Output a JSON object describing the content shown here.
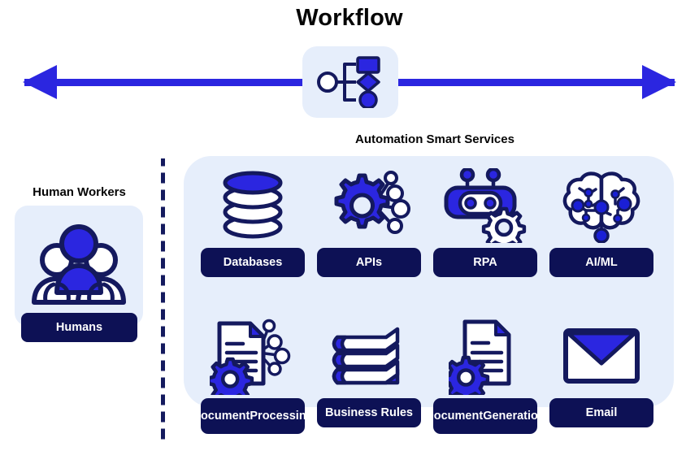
{
  "title": "Workflow",
  "colors": {
    "arrow_blue": "#2B26E0",
    "panel_blue": "#E6EEFB",
    "label_navy": "#0D1155",
    "outline_navy": "#14195E",
    "icon_blue": "#2B26E0",
    "text_black": "#050505",
    "label_text": "#FFFFFF",
    "background": "#FFFFFF"
  },
  "workflow_icon": {
    "name": "workflow-diagram-icon",
    "shapes": [
      "circle-outline",
      "bracket-connector",
      "square-filled",
      "diamond-filled",
      "circle-filled"
    ]
  },
  "arrows": {
    "left": "arrow-left",
    "right": "arrow-right"
  },
  "human_section": {
    "title": "Human Workers",
    "icon": "three-people-icon",
    "label": "Humans"
  },
  "divider": {
    "name": "dashed-vertical-divider",
    "style": "dashed"
  },
  "services_section": {
    "title": "Automation Smart Services",
    "rows": [
      {
        "items": [
          {
            "label": "Databases",
            "label_lines": [
              "Databases"
            ],
            "icon": "database-stack-icon"
          },
          {
            "label": "APIs",
            "label_lines": [
              "APIs"
            ],
            "icon": "gear-network-icon"
          },
          {
            "label": "RPA",
            "label_lines": [
              "RPA"
            ],
            "icon": "robot-gear-icon"
          },
          {
            "label": "AI/ML",
            "label_lines": [
              "AI/ML"
            ],
            "icon": "brain-circuit-icon"
          }
        ]
      },
      {
        "items": [
          {
            "label": "Document Processing",
            "label_lines": [
              "Document",
              "Processing"
            ],
            "icon": "document-gear-network-icon"
          },
          {
            "label": "Business Rules",
            "label_lines": [
              "Business Rules"
            ],
            "icon": "book-stack-icon"
          },
          {
            "label": "Document Generation",
            "label_lines": [
              "Document",
              "Generation"
            ],
            "icon": "document-gear-icon"
          },
          {
            "label": "Email",
            "label_lines": [
              "Email"
            ],
            "icon": "envelope-icon"
          }
        ]
      }
    ]
  }
}
